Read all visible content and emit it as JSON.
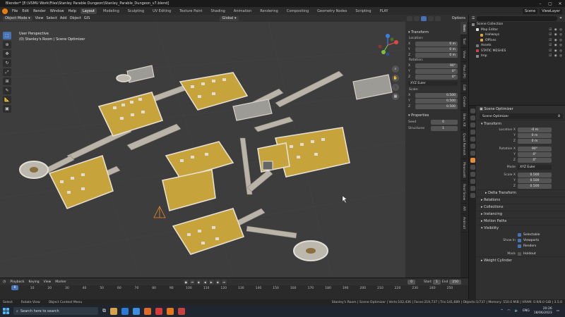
{
  "window": {
    "title": "Blender* [E:\\VSMU Work\\Files\\Stanley Parable Dungeon\\Stanley_Parable_Dungeon_v7.blend]"
  },
  "menubar": {
    "items": [
      "File",
      "Edit",
      "Render",
      "Window",
      "Help"
    ],
    "workspaces": [
      "Layout",
      "Modeling",
      "Sculpting",
      "UV Editing",
      "Texture Paint",
      "Shading",
      "Animation",
      "Rendering",
      "Compositing",
      "Geometry Nodes",
      "Scripting",
      "PLAY"
    ],
    "active_workspace": "Layout",
    "scene": "Scene",
    "view_layer": "ViewLayer"
  },
  "viewport_header": {
    "mode": "Object Mode",
    "menus": [
      "View",
      "Select",
      "Add",
      "Object",
      "GIS"
    ],
    "orientation": "Global",
    "options": "Options"
  },
  "viewport": {
    "perspective": "User Perspective",
    "context": "(0) Stanley's Room | Scene Optimizer",
    "background_color": "#3d3d3d",
    "floor_color": "#c7a33b",
    "wall_color": "#d8d2c6"
  },
  "toolbar": {
    "tools": [
      "select-box",
      "cursor",
      "move",
      "rotate",
      "scale",
      "transform",
      "annotate",
      "measure",
      "add-cube"
    ]
  },
  "npanel": {
    "transform_title": "Transform",
    "location_label": "Location:",
    "location": {
      "x": "0 m",
      "y": "0 m",
      "z": "0 m"
    },
    "rotation_label": "Rotation:",
    "rotation": {
      "x": "90°",
      "y": "0°",
      "z": "0°"
    },
    "rotation_mode": "XYZ Euler",
    "scale_label": "Scale:",
    "scale": {
      "x": "0.500",
      "y": "0.500",
      "z": "0.500"
    },
    "properties_title": "Properties",
    "seed_label": "Seed",
    "seed": "0",
    "structures_label": "Structures",
    "structures": "1",
    "axis": {
      "x": "X",
      "y": "Y",
      "z": "Z"
    },
    "tabs": [
      "Item",
      "Tool",
      "View",
      "Plan (Pt)",
      "Edit",
      "Create",
      "Blen. Kit",
      "BlenderKit",
      "Quad Remesh",
      "Measurelt",
      "Real Snow",
      "AR",
      "Animall",
      "ReaLTime Materials"
    ]
  },
  "outliner": {
    "items": [
      {
        "name": "Scene Collection",
        "depth": 0,
        "color": "#8a8a8a"
      },
      {
        "name": "Map Editor",
        "depth": 1,
        "color": "#e0e0e0"
      },
      {
        "name": "Hallways",
        "depth": 2,
        "color": "#d9a441"
      },
      {
        "name": "Offices",
        "depth": 2,
        "color": "#d9a441"
      },
      {
        "name": "Assets",
        "depth": 1,
        "color": "#7a7a7a"
      },
      {
        "name": "STATIC MESHES",
        "depth": 1,
        "color": "#c94747"
      },
      {
        "name": "Imp",
        "depth": 1,
        "color": "#8a8a8a"
      }
    ]
  },
  "properties": {
    "header": "Scene Optimizer",
    "name_field": "Scene Optimizer",
    "name_users": "8",
    "transform_title": "Transform",
    "location_label": "Location X",
    "location": [
      "-0 m",
      "0 m",
      "0 m"
    ],
    "rotation_label": "Rotation X",
    "rotation": [
      "90°",
      "0°",
      "0°"
    ],
    "mode_label": "Mode",
    "mode": "XYZ Euler",
    "scale_label": "Scale X",
    "scale": [
      "0.500",
      "0.500",
      "0.500"
    ],
    "delta": "Delta Transform",
    "sections": [
      "Relations",
      "Collections",
      "Instancing",
      "Motion Paths"
    ],
    "visibility": "Visibility",
    "selectable": "Selectable",
    "show_in_label": "Show In",
    "viewports": "Viewports",
    "renders": "Renders",
    "mask_label": "Mask",
    "holdout": "Holdout",
    "weight_cylinder": "Weight Cylinder",
    "axis": {
      "y": "Y",
      "z": "Z"
    }
  },
  "timeline": {
    "menus": [
      "Playback",
      "Keying",
      "View",
      "Marker"
    ],
    "current_frame": "0",
    "start_label": "Start",
    "start": "1",
    "end_label": "End",
    "end": "250",
    "ticks": [
      "0",
      "10",
      "20",
      "30",
      "40",
      "50",
      "60",
      "70",
      "80",
      "90",
      "100",
      "110",
      "120",
      "130",
      "140",
      "150",
      "160",
      "170",
      "180",
      "190",
      "200",
      "210",
      "220",
      "230",
      "240",
      "250"
    ]
  },
  "statusbar": {
    "select": "Select",
    "rotate": "Rotate View",
    "context": "Object Context Menu",
    "stats": "Stanley's Room | Scene Optimizer | Verts:102,436 | Faces:219,737 | Tris:141,689 | Objects:1/737 | Memory: 550.0 MiB | VRAM: 0.9/8.0 GiB | 3.5.0"
  },
  "taskbar": {
    "search": "Search here to search",
    "language": "ENG",
    "time": "20:26",
    "date": "18/06/2023",
    "app_colors": [
      "#d7a34d",
      "#2d7bd6",
      "#3d8ee0",
      "#de6b2a",
      "#d83a3a",
      "#e8761a",
      "#c94040"
    ]
  }
}
